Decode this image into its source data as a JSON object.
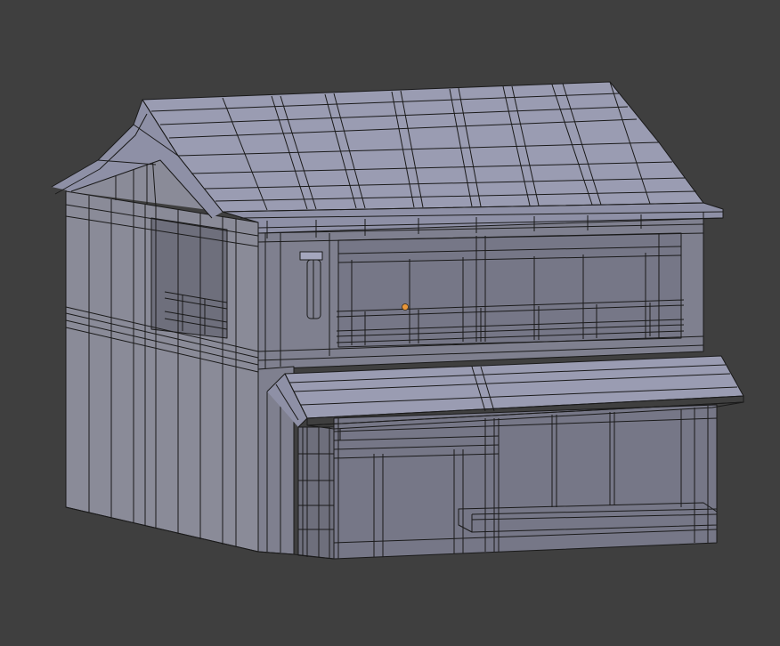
{
  "viewport": {
    "background": "#3f3f3f",
    "object": "building-mesh",
    "mode": "wireframe-solid",
    "mesh_color": "#8e90a6",
    "edge_color": "#1a1a1a",
    "origin_color": "#e8963a"
  }
}
